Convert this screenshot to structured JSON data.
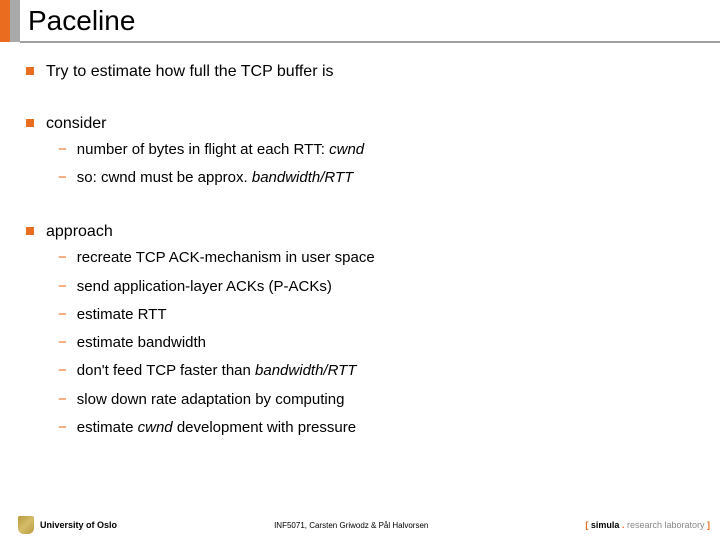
{
  "title": "Paceline",
  "bullets": {
    "b1": "Try to estimate how full the TCP buffer is",
    "b2": "consider",
    "b2subs": {
      "s0a": "number of bytes in flight at each RTT: ",
      "s0b": "cwnd",
      "s1a": "so: cwnd must be approx. ",
      "s1b": "bandwidth/RTT"
    },
    "b3": "approach",
    "b3subs": {
      "s0": "recreate TCP ACK-mechanism in user space",
      "s1": "send application-layer ACKs (P-ACKs)",
      "s2": "estimate RTT",
      "s3": "estimate bandwidth",
      "s4a": "don't feed TCP faster than ",
      "s4b": "bandwidth/RTT",
      "s5": "slow down rate adaptation by computing",
      "s6a": "estimate ",
      "s6b": "cwnd",
      "s6c": " development with pressure"
    }
  },
  "footer": {
    "university": "University of Oslo",
    "center": "INF5071, Carsten Griwodz & Pål Halvorsen",
    "lab_open": "[ ",
    "lab_brand": "simula",
    "lab_dot": " . ",
    "lab_rest": "research laboratory",
    "lab_close": " ]"
  }
}
